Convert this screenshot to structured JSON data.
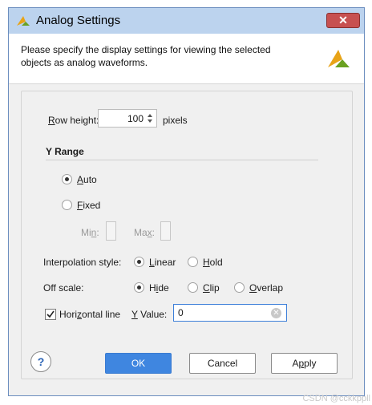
{
  "window": {
    "title": "Analog Settings",
    "close_label": "✕"
  },
  "header": {
    "description": "Please specify the display settings for viewing the selected objects as analog waveforms."
  },
  "row_height": {
    "label_mnemonic": "R",
    "label_rest": "ow height:",
    "value": "100",
    "unit": "pixels"
  },
  "y_range": {
    "heading": "Y Range",
    "auto": {
      "mnemonic": "A",
      "rest": "uto",
      "selected": true
    },
    "fixed": {
      "mnemonic": "F",
      "rest": "ixed",
      "selected": false
    },
    "min_label_pre": "Mi",
    "min_label_mn": "n",
    "min_label_post": ":",
    "max_label_pre": "Ma",
    "max_label_mn": "x",
    "max_label_post": ":"
  },
  "interpolation": {
    "label": "Interpolation style:",
    "linear": {
      "mnemonic": "L",
      "rest": "inear",
      "selected": true
    },
    "hold": {
      "mnemonic": "H",
      "rest": "old",
      "selected": false
    }
  },
  "off_scale": {
    "label": "Off scale:",
    "hide": {
      "pre": "H",
      "mnemonic": "i",
      "rest": "de",
      "selected": true
    },
    "clip": {
      "mnemonic": "C",
      "rest": "lip",
      "selected": false
    },
    "overlap": {
      "mnemonic": "O",
      "rest": "verlap",
      "selected": false
    }
  },
  "horizontal_line": {
    "label_pre": "Hori",
    "label_mn": "z",
    "label_post": "ontal line",
    "checked": true,
    "y_value_mnemonic": "Y",
    "y_value_rest": " Value:",
    "y_value": "0"
  },
  "buttons": {
    "help": "?",
    "ok": "OK",
    "cancel": "Cancel",
    "apply_pre": "A",
    "apply_mn": "p",
    "apply_post": "ply"
  },
  "watermark": "CSDN @cckkppll",
  "colors": {
    "titlebar": "#bcd3ee",
    "accent": "#3f86e0",
    "close": "#c75050",
    "logo_gold": "#e8a317",
    "logo_green": "#6aa121"
  }
}
